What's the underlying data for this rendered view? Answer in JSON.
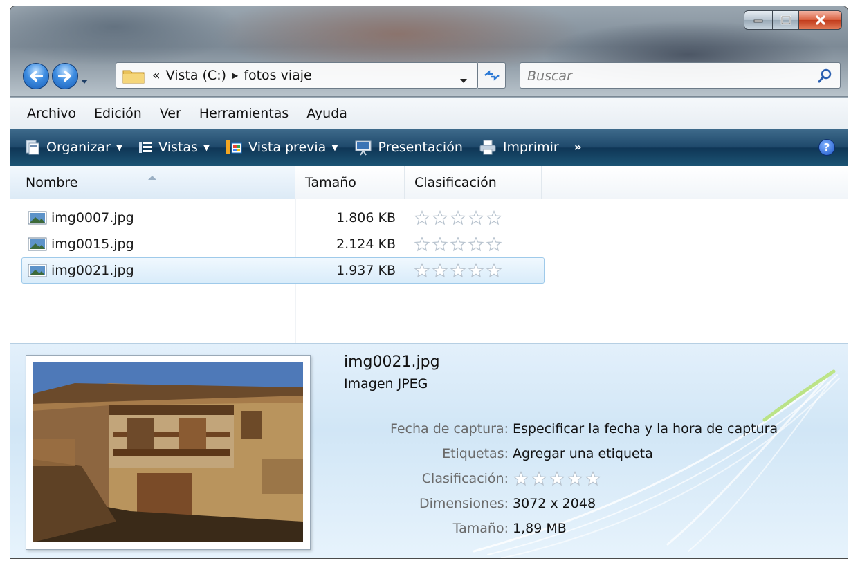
{
  "window": {
    "caption_buttons": [
      "minimize",
      "maximize",
      "close"
    ]
  },
  "address_bar": {
    "prefix": "«",
    "segments": [
      "Vista (C:)",
      "fotos viaje"
    ]
  },
  "search": {
    "placeholder": "Buscar"
  },
  "menu": [
    "Archivo",
    "Edición",
    "Ver",
    "Herramientas",
    "Ayuda"
  ],
  "commands": [
    {
      "label": "Organizar",
      "icon": "organize-icon"
    },
    {
      "label": "Vistas",
      "icon": "views-icon"
    },
    {
      "label": "Vista previa",
      "icon": "preview-icon"
    },
    {
      "label": "Presentación",
      "icon": "slideshow-icon"
    },
    {
      "label": "Imprimir",
      "icon": "printer-icon"
    }
  ],
  "more_label": "»",
  "help_label": "?",
  "columns": {
    "name": "Nombre",
    "size": "Tamaño",
    "rating": "Clasificación"
  },
  "files": [
    {
      "name": "img0007.jpg",
      "size": "1.806 KB",
      "rating": 0,
      "selected": false
    },
    {
      "name": "img0015.jpg",
      "size": "2.124 KB",
      "rating": 0,
      "selected": false
    },
    {
      "name": "img0021.jpg",
      "size": "1.937 KB",
      "rating": 0,
      "selected": true
    }
  ],
  "details": {
    "title": "img0021.jpg",
    "type": "Imagen JPEG",
    "properties": [
      {
        "key": "Fecha de captura:",
        "value": "Especificar la fecha y la hora de captura"
      },
      {
        "key": "Etiquetas:",
        "value": "Agregar una etiqueta"
      },
      {
        "key": "Clasificación:",
        "value": "",
        "rating": 0
      },
      {
        "key": "Dimensiones:",
        "value": "3072 x 2048"
      },
      {
        "key": "Tamaño:",
        "value": "1,89 MB"
      }
    ]
  },
  "colors": {
    "command_bar": "#1f4a6c",
    "selection": "#d9ecfa",
    "details_bg": "#d1e6f6"
  }
}
